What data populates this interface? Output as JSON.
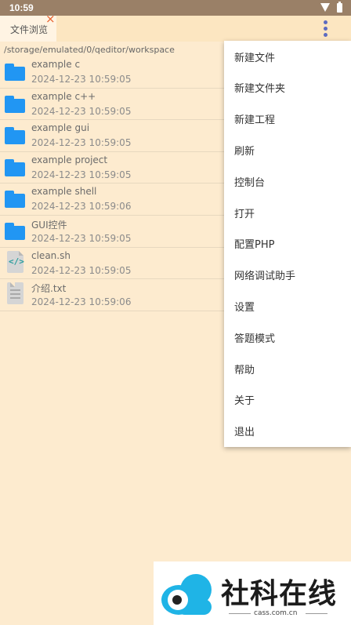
{
  "status_bar": {
    "time": "10:59"
  },
  "tab": {
    "label": "文件浏览",
    "close_glyph": "×"
  },
  "path": "/storage/emulated/0/qeditor/workspace",
  "files": [
    {
      "name": "example c",
      "date": "2024-12-23 10:59:05",
      "icon": "folder-icon"
    },
    {
      "name": "example c++",
      "date": "2024-12-23 10:59:05",
      "icon": "folder-icon"
    },
    {
      "name": "example gui",
      "date": "2024-12-23 10:59:05",
      "icon": "folder-icon"
    },
    {
      "name": "example project",
      "date": "2024-12-23 10:59:05",
      "icon": "folder-icon"
    },
    {
      "name": "example shell",
      "date": "2024-12-23 10:59:06",
      "icon": "folder-icon"
    },
    {
      "name": "GUI控件",
      "date": "2024-12-23 10:59:05",
      "icon": "folder-icon"
    },
    {
      "name": "clean.sh",
      "date": "2024-12-23 10:59:05",
      "icon": "code-file-icon"
    },
    {
      "name": "介绍.txt",
      "date": "2024-12-23 10:59:06",
      "icon": "text-file-icon"
    }
  ],
  "menu": {
    "items": [
      "新建文件",
      "新建文件夹",
      "新建工程",
      "刷新",
      "控制台",
      "打开",
      "配置PHP",
      "网络调试助手",
      "设置",
      "答题模式",
      "帮助",
      "关于",
      "退出"
    ]
  },
  "watermark": {
    "text": "社科在线",
    "url": "cass.com.cn"
  },
  "colors": {
    "background": "#fdebcf",
    "status_bar": "#9a8067",
    "folder": "#2196f3",
    "accent": "#5c6bc0",
    "close": "#e8602c"
  }
}
